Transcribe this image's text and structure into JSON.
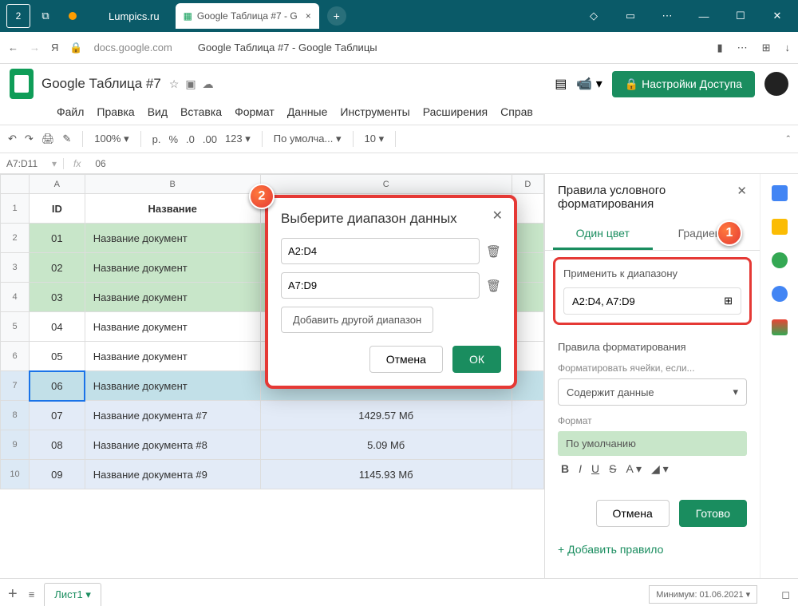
{
  "titlebar": {
    "home": "2",
    "tab1": "Lumpics.ru",
    "tab2": "Google Таблица #7 - G",
    "tab2_x": "×",
    "plus": "+"
  },
  "addr": {
    "back": "←",
    "fwd": "→",
    "url": "docs.google.com",
    "title": "Google Таблица #7 - Google Таблицы"
  },
  "doc": {
    "name": "Google Таблица #7",
    "share": "Настройки Доступа",
    "lock": "🔒"
  },
  "menu": [
    "Файл",
    "Правка",
    "Вид",
    "Вставка",
    "Формат",
    "Данные",
    "Инструменты",
    "Расширения",
    "Справ"
  ],
  "tb": {
    "zoom": "100%",
    "cur": "р.",
    "pct": "%",
    "dec1": ".0",
    "dec2": ".00",
    "num": "123",
    "font": "По умолча...",
    "size": "10"
  },
  "nb": {
    "ref": "A7:D11",
    "fx": "fx",
    "val": "06"
  },
  "cols": [
    "",
    "A",
    "B",
    "C",
    "D"
  ],
  "headers": {
    "id": "ID",
    "name": "Название"
  },
  "rows": [
    {
      "n": "1",
      "header": true
    },
    {
      "n": "2",
      "id": "01",
      "name": "Название документ",
      "cls": "green"
    },
    {
      "n": "3",
      "id": "02",
      "name": "Название документ",
      "cls": "green"
    },
    {
      "n": "4",
      "id": "03",
      "name": "Название документ",
      "cls": "green"
    },
    {
      "n": "5",
      "id": "04",
      "name": "Название документ"
    },
    {
      "n": "6",
      "id": "05",
      "name": "Название документ"
    },
    {
      "n": "7",
      "id": "06",
      "name": "Название документ",
      "cls": "selrow"
    },
    {
      "n": "8",
      "id": "07",
      "name": "Название документа #7",
      "size": "1429.57 Мб",
      "cls": "blue"
    },
    {
      "n": "9",
      "id": "08",
      "name": "Название документа #8",
      "size": "5.09 Мб",
      "cls": "blue"
    },
    {
      "n": "10",
      "id": "09",
      "name": "Название документа #9",
      "size": "1145.93 Мб",
      "cls": "blue"
    }
  ],
  "dialog": {
    "title": "Выберите диапазон данных",
    "r1": "A2:D4",
    "r2": "A7:D9",
    "add": "Добавить другой диапазон",
    "cancel": "Отмена",
    "ok": "ОК"
  },
  "panel": {
    "title": "Правила условного форматирования",
    "tab1": "Один цвет",
    "tab2": "Градиент",
    "applyLabel": "Применить к диапазону",
    "range": "A2:D4, A7:D9",
    "rulesLabel": "Правила форматирования",
    "condLabel": "Форматировать ячейки, если...",
    "cond": "Содержит данные",
    "fmtLabel": "Формат",
    "fmtVal": "По умолчанию",
    "cancel": "Отмена",
    "done": "Готово",
    "add": "+  Добавить правило"
  },
  "markers": {
    "m1": "1",
    "m2": "2"
  },
  "bottom": {
    "sheet": "Лист1",
    "min": "Минимум: 01.06.2021",
    "plus": "+",
    "menu": "≡",
    "dd": "▾"
  }
}
